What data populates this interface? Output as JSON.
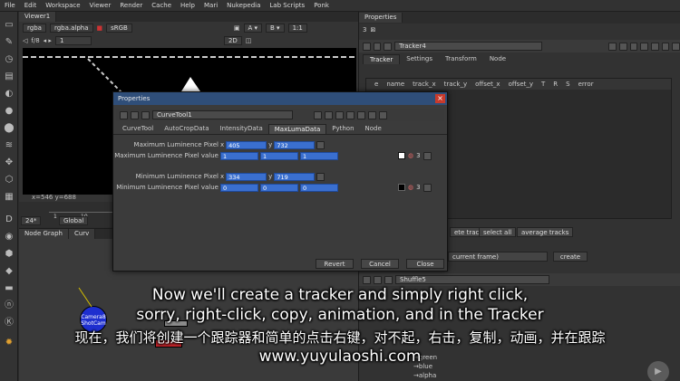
{
  "menubar": [
    "File",
    "Edit",
    "Workspace",
    "Viewer",
    "Render",
    "Cache",
    "Help",
    "Mari",
    "Nukepedia",
    "Lab Scripts",
    "Ponk"
  ],
  "viewer": {
    "tab": "Viewer1",
    "channels": "rgba",
    "alpha": "rgba.alpha",
    "colorspace": "sRGB",
    "fstop": "f/8",
    "frame": "1",
    "zoom": "1:1",
    "mode": "2D",
    "coords": "x=546 y=688",
    "fps": "24*",
    "scope": "Global",
    "tl_start": "1",
    "tl_mark": "10"
  },
  "nodegraph": {
    "tab1": "Node Graph",
    "tab2": "Curv",
    "node_label": "Camera8\nShotCam"
  },
  "properties": {
    "title": "Properties",
    "count": "3",
    "node_name": "Tracker4",
    "tabs": [
      "Tracker",
      "Settings",
      "Transform",
      "Node"
    ],
    "columns": [
      "e",
      "name",
      "track_x",
      "track_y",
      "offset_x",
      "offset_y",
      "T",
      "R",
      "S",
      "error"
    ],
    "btn_delete": "ete tracks",
    "btn_select_all": "select all",
    "btn_average": "average tracks",
    "frame_dd": "current frame)",
    "btn_create": "create",
    "shuffle_name": "Shuffle5",
    "shuffle_labels": [
      "green",
      "blue",
      "alpha"
    ]
  },
  "dialog": {
    "title": "Properties",
    "node_name": "CurveTool1",
    "tabs": [
      "CurveTool",
      "AutoCropData",
      "IntensityData",
      "MaxLumaData",
      "Python",
      "Node"
    ],
    "active_tab": 3,
    "max_pixel_label": "Maximum Luminence Pixel",
    "max_pixel_x": "405",
    "max_pixel_y": "732",
    "max_value_label": "Maximum Luminence Pixel value",
    "max_value": [
      "1",
      "1",
      "1"
    ],
    "min_pixel_label": "Minimum Luminence Pixel",
    "min_pixel_x": "334",
    "min_pixel_y": "719",
    "min_value_label": "Minimum Luminence Pixel value",
    "min_value": [
      "0",
      "0",
      "0"
    ],
    "x_label": "x",
    "y_label": "y",
    "swatch_count": "3",
    "revert": "Revert",
    "cancel": "Cancel",
    "close": "Close"
  },
  "subtitles": {
    "en1": "Now we'll create a tracker and simply right click,",
    "en2": "sorry, right-click, copy, animation, and in the Tracker",
    "zh": "现在，我们将创建一个跟踪器和简单的点击右键，对不起，右击，复制，动画，并在跟踪",
    "watermark": "www.yuyulaoshi.com"
  },
  "colors": {
    "selection": "#3a6fcf",
    "dialog_title": "#2f4e79",
    "close_button": "#c83a2c",
    "node_camera": "#1e2fcf",
    "node_red": "#c0242a"
  }
}
